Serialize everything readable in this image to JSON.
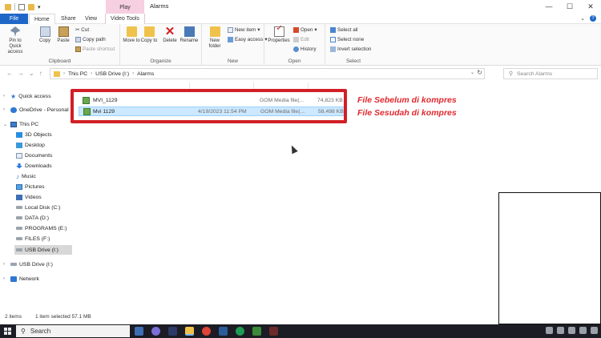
{
  "window": {
    "title": "Alarms",
    "contextual_group": "Play",
    "controls": {
      "minimize": "—",
      "maximize": "☐",
      "close": "✕"
    }
  },
  "tabs": {
    "file": "File",
    "home": "Home",
    "share": "Share",
    "view": "View",
    "video_tools": "Video Tools"
  },
  "ribbon": {
    "clipboard": {
      "label": "Clipboard",
      "pin": "Pin to Quick access",
      "copy": "Copy",
      "paste": "Paste",
      "cut": "Cut",
      "copy_path": "Copy path",
      "paste_shortcut": "Paste shortcut"
    },
    "organize": {
      "label": "Organize",
      "move_to": "Move to",
      "copy_to": "Copy to",
      "delete": "Delete",
      "rename": "Rename"
    },
    "new": {
      "label": "New",
      "new_folder": "New folder",
      "new_item": "New item",
      "easy_access": "Easy access"
    },
    "open": {
      "label": "Open",
      "properties": "Properties",
      "open": "Open",
      "edit": "Edit",
      "history": "History"
    },
    "select": {
      "label": "Select",
      "select_all": "Select all",
      "select_none": "Select none",
      "invert_selection": "Invert selection"
    }
  },
  "address": {
    "crumbs": [
      "This PC",
      "USB Drive (I:)",
      "Alarms"
    ],
    "search_placeholder": "Search Alarms"
  },
  "nav": {
    "quick_access": "Quick access",
    "onedrive": "OneDrive - Personal",
    "this_pc": "This PC",
    "objects3d": "3D Objects",
    "desktop": "Desktop",
    "documents": "Documents",
    "downloads": "Downloads",
    "music": "Music",
    "pictures": "Pictures",
    "videos": "Videos",
    "local_disk": "Local Disk (C:)",
    "data": "DATA (D:)",
    "programs": "PROGRAMS (E:)",
    "files": "FILES (F:)",
    "usb_selected": "USB Drive (I:)",
    "usb": "USB Drive (I:)",
    "network": "Network"
  },
  "files": [
    {
      "name": "MVI_1129",
      "date": "",
      "type": "GOM Media file(...",
      "size": "74,823 KB"
    },
    {
      "name": "Mvi 1129",
      "date": "4/19/2023 11:54 PM",
      "type": "GOM Media file(...",
      "size": "58,498 KB"
    }
  ],
  "annotations": {
    "before": "File Sebelum di kompres",
    "after": "File Sesudah di kompres"
  },
  "status": {
    "items": "2 items",
    "selected": "1 item selected  57.1 MB"
  },
  "taskbar": {
    "search": "Search"
  },
  "colors": {
    "file_tab": "#1e67c8",
    "selection": "#cce8ff",
    "annotation": "#e0282e",
    "play_tab": "#f6cfe1"
  }
}
